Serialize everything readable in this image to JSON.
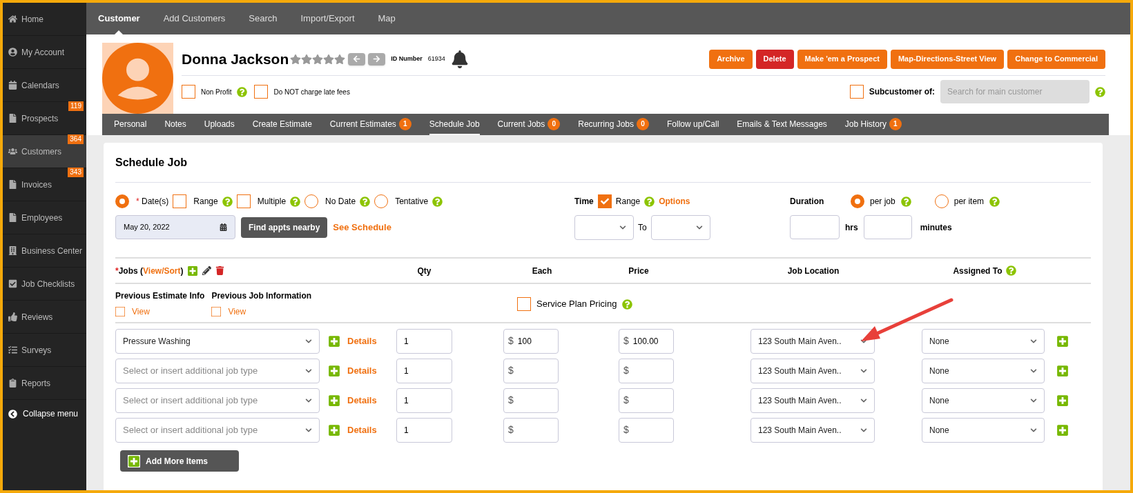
{
  "sidebar": {
    "items": [
      {
        "label": "Home",
        "selected": false
      },
      {
        "label": "My Account",
        "selected": false
      },
      {
        "label": "Calendars",
        "selected": false
      },
      {
        "label": "Prospects",
        "badge": "119",
        "selected": false
      },
      {
        "label": "Customers",
        "badge": "364",
        "selected": true
      },
      {
        "label": "Invoices",
        "badge": "343",
        "selected": false
      },
      {
        "label": "Employees",
        "selected": false
      },
      {
        "label": "Business Center",
        "selected": false
      },
      {
        "label": "Job Checklists",
        "selected": false
      },
      {
        "label": "Reviews",
        "selected": false
      },
      {
        "label": "Surveys",
        "selected": false
      },
      {
        "label": "Reports",
        "selected": false
      }
    ],
    "collapse": "Collapse menu"
  },
  "top_nav": [
    {
      "label": "Customer",
      "selected": true
    },
    {
      "label": "Add Customers",
      "selected": false
    },
    {
      "label": "Search",
      "selected": false
    },
    {
      "label": "Import/Export",
      "selected": false
    },
    {
      "label": "Map",
      "selected": false
    }
  ],
  "customer": {
    "name": "Donna Jackson",
    "id_label": "ID Number",
    "id": "61934",
    "flags": [
      {
        "label": "Non Profit",
        "checked": false,
        "help": true
      },
      {
        "label": "Do NOT charge late fees",
        "checked": false,
        "help": false
      }
    ],
    "actions": [
      {
        "label": "Archive",
        "kind": "primary"
      },
      {
        "label": "Delete",
        "kind": "danger"
      },
      {
        "label": "Make 'em a Prospect",
        "kind": "primary"
      },
      {
        "label": "Map-Directions-Street View",
        "kind": "primary"
      },
      {
        "label": "Change to Commercial",
        "kind": "primary"
      }
    ],
    "subcustomer": {
      "label": "Subcustomer of:",
      "checked": false,
      "placeholder": "Search for main customer"
    }
  },
  "tabs": [
    {
      "label": "Personal",
      "selected": false
    },
    {
      "label": "Notes",
      "selected": false
    },
    {
      "label": "Uploads",
      "selected": false
    },
    {
      "label": "Create Estimate",
      "selected": false
    },
    {
      "label": "Current Estimates",
      "badge": "1",
      "selected": false
    },
    {
      "label": "Schedule Job",
      "selected": true
    },
    {
      "label": "Current Jobs",
      "badge": "0",
      "selected": false
    },
    {
      "label": "Recurring Jobs",
      "badge": "0",
      "selected": false
    },
    {
      "label": "Follow up/Call",
      "selected": false
    },
    {
      "label": "Emails & Text Messages",
      "selected": false
    },
    {
      "label": "Job History",
      "badge": "1",
      "selected": false
    }
  ],
  "schedule": {
    "title": "Schedule Job",
    "date_options": [
      {
        "kind": "radio",
        "prefix": "*",
        "label": "Date(s)",
        "selected": true,
        "help": false
      },
      {
        "kind": "checkbox",
        "label": "Range",
        "checked": false,
        "help": true
      },
      {
        "kind": "checkbox",
        "label": "Multiple",
        "checked": false,
        "help": true
      },
      {
        "kind": "radio",
        "label": "No Date",
        "selected": false,
        "help": true
      },
      {
        "kind": "radio",
        "label": "Tentative",
        "selected": false,
        "help": true
      }
    ],
    "date": "May 20, 2022",
    "find_button": "Find appts nearby",
    "see_schedule": "See Schedule",
    "time": {
      "label": "Time",
      "range_label": "Range",
      "range_checked": true,
      "options_link": "Options",
      "to": "To"
    },
    "duration": {
      "label": "Duration",
      "options": [
        {
          "label": "per job",
          "selected": true
        },
        {
          "label": "per item",
          "selected": false
        }
      ],
      "hrs": "hrs",
      "minutes": "minutes"
    },
    "jobs_header": {
      "mark": "*",
      "before": "Jobs (",
      "link": "View/Sort",
      "after": ")"
    },
    "columns": [
      {
        "label": "Qty",
        "help": false
      },
      {
        "label": "Each",
        "help": false
      },
      {
        "label": "Price",
        "help": false
      },
      {
        "label": "Job Location",
        "help": false
      },
      {
        "label": "Assigned To",
        "help": true
      }
    ],
    "previous": [
      {
        "title": "Previous Estimate Info",
        "link": "View",
        "checked": false
      },
      {
        "title": "Previous Job Information",
        "link": "View",
        "checked": false
      }
    ],
    "service_plan": {
      "label": "Service Plan Pricing",
      "checked": false
    },
    "rows": [
      {
        "job": "Pressure Washing",
        "details": "Details",
        "qty": "1",
        "each_prefix": "$",
        "each": "100",
        "price_prefix": "$",
        "price": "100.00",
        "location": "123 South Main Aven..",
        "assigned": "None"
      },
      {
        "placeholder": "Select or insert additional job type",
        "details": "Details",
        "qty": "1",
        "each_prefix": "$",
        "price_prefix": "$",
        "location": "123 South Main Aven..",
        "assigned": "None"
      },
      {
        "placeholder": "Select or insert additional job type",
        "details": "Details",
        "qty": "1",
        "each_prefix": "$",
        "price_prefix": "$",
        "location": "123 South Main Aven..",
        "assigned": "None"
      },
      {
        "placeholder": "Select or insert additional job type",
        "details": "Details",
        "qty": "1",
        "each_prefix": "$",
        "price_prefix": "$",
        "location": "123 South Main Aven..",
        "assigned": "None"
      }
    ],
    "add_more": "Add More Items"
  }
}
